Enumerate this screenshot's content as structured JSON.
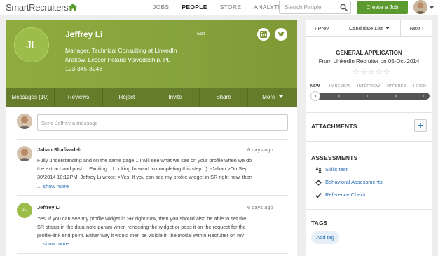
{
  "topbar": {
    "logo": "SmartRecruiters",
    "nav": [
      "JOBS",
      "PEOPLE",
      "STORE",
      "ANALYTICS"
    ],
    "active_nav": "PEOPLE",
    "search_placeholder": "Search People",
    "create_label": "Create a Job"
  },
  "profile": {
    "initials": "JL",
    "name": "Jeffrey Li",
    "edit_label": "Edit",
    "title": "Manager, Technical Consulting at LinkedIn",
    "location": "Krakow, Lesser Poland Voivodeship, PL",
    "phone": "123-345-3243"
  },
  "tabs": [
    "Messages (10)",
    "Reviews",
    "Reject",
    "Invite",
    "Share",
    "More"
  ],
  "compose_placeholder": "Send Jeffrey a message",
  "messages": [
    {
      "author": "Jahan Shafizadeh",
      "time": "6 days ago",
      "lines": [
        "Fully understanding and on the same page... I will see what we see on your profile when we do",
        "the extract and push... Exciting... Looking forward to completing this step. :). -Jahan >On Sep",
        "30/2014 10:12PM, Jeffrey Li wrote: >Yes. If you can see my profile widget in SR right now, then"
      ],
      "more": "show more"
    },
    {
      "author": "Jeffrey Li",
      "initials": "JL",
      "time": "6 days ago",
      "lines": [
        "Yes. If you can see my profile widget in SR right now, then you should also be able to set the",
        "SR status in the data-note param when rendering the widget or pass it on the request for the",
        "profile-link end point. Either way it would then be visible in the modal within Recruiter on my"
      ],
      "more": "show more"
    }
  ],
  "right": {
    "prev_label": "Prev",
    "list_label": "Candidate List",
    "next_label": "Next",
    "app_title": "GENERAL APPLICATION",
    "app_source": "From LinkedIn Recruiter on 05-Oct-2014",
    "rating_stars": "☆☆☆☆☆",
    "stages": [
      "NEW",
      "IN REVIEW",
      "INTERVIEW",
      "OFFERED",
      "HIRED"
    ],
    "current_stage": "NEW",
    "attachments_label": "ATTACHMENTS",
    "assessments_label": "ASSESSMENTS",
    "assessments": [
      "Skills test",
      "Behavioral Assessments",
      "Reference Check"
    ],
    "tags_label": "TAGS",
    "add_tag_label": "Add tag"
  },
  "colors": {
    "brand_green": "#5a9a2f",
    "profile_green": "#8fac3f",
    "tab_bar": "#657d2a",
    "link_blue": "#2c6fb5"
  }
}
